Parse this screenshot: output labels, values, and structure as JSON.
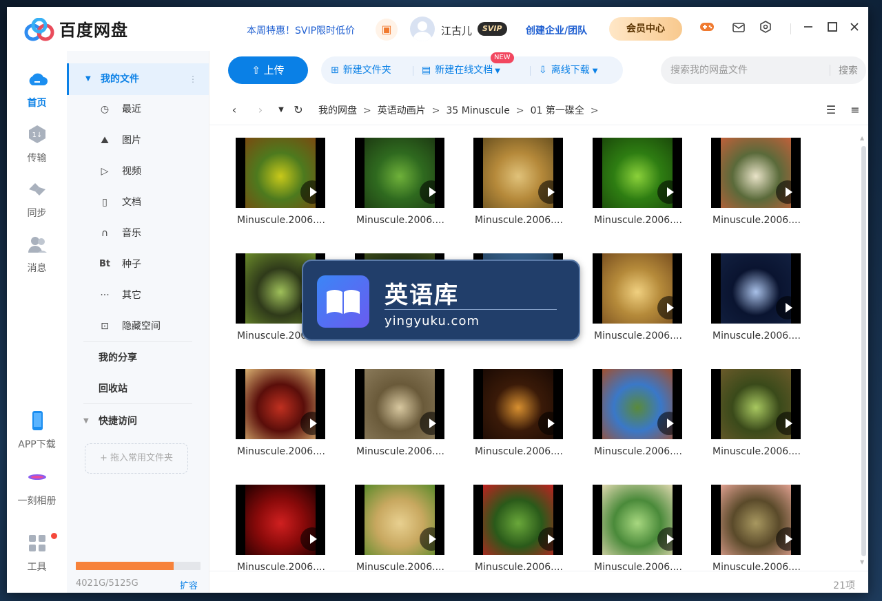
{
  "titlebar": {
    "brand": "百度网盘",
    "promo": "本周特惠！SVIP限时低价",
    "username": "江古儿",
    "svip_badge": "SVIP",
    "team_link": "创建企业/团队",
    "vip_center": "会员中心"
  },
  "rail": {
    "home": "首页",
    "transfer": "传输",
    "sync": "同步",
    "messages": "消息",
    "app_download": "APP下载",
    "album": "一刻相册",
    "tools": "工具"
  },
  "tree": {
    "my_files": "我的文件",
    "items": [
      {
        "label": "最近",
        "icon": "clock-icon"
      },
      {
        "label": "图片",
        "icon": "image-icon"
      },
      {
        "label": "视频",
        "icon": "video-icon"
      },
      {
        "label": "文档",
        "icon": "document-icon"
      },
      {
        "label": "音乐",
        "icon": "headphones-icon"
      },
      {
        "label": "种子",
        "icon": "bt-icon"
      },
      {
        "label": "其它",
        "icon": "more-icon"
      },
      {
        "label": "隐藏空间",
        "icon": "lock-icon"
      }
    ],
    "my_share": "我的分享",
    "recycle": "回收站",
    "quick_access": "快捷访问",
    "drop_hint": "+ 拖入常用文件夹",
    "quota_text": "4021G/5125G",
    "quota_used_fraction": 0.785,
    "expand": "扩容"
  },
  "toolbar": {
    "upload": "上传",
    "new_folder": "新建文件夹",
    "new_online_doc": "新建在线文档",
    "new_tag": "NEW",
    "offline_download": "离线下载",
    "search_placeholder": "搜索我的网盘文件",
    "search_button": "搜索"
  },
  "breadcrumb": [
    "我的网盘",
    "英语动画片",
    "35 Minuscule",
    "01 第一碟全"
  ],
  "files": [
    {
      "name": "Minuscule.2006...."
    },
    {
      "name": "Minuscule.2006...."
    },
    {
      "name": "Minuscule.2006...."
    },
    {
      "name": "Minuscule.2006...."
    },
    {
      "name": "Minuscule.2006...."
    },
    {
      "name": "Minuscule.2006...."
    },
    {
      "name": "Minuscule.2006...."
    },
    {
      "name": "Minuscule.2006...."
    },
    {
      "name": "Minuscule.2006...."
    },
    {
      "name": "Minuscule.2006...."
    },
    {
      "name": "Minuscule.2006...."
    },
    {
      "name": "Minuscule.2006...."
    },
    {
      "name": "Minuscule.2006...."
    },
    {
      "name": "Minuscule.2006...."
    },
    {
      "name": "Minuscule.2006...."
    },
    {
      "name": "Minuscule.2006...."
    },
    {
      "name": "Minuscule.2006...."
    },
    {
      "name": "Minuscule.2006...."
    },
    {
      "name": "Minuscule.2006...."
    },
    {
      "name": "Minuscule.2006...."
    }
  ],
  "item_count": "21项",
  "watermark": {
    "title": "英语库",
    "url": "yingyuku.com"
  },
  "colors": {
    "accent": "#0a80e6",
    "quota_fill": "#f7823a"
  }
}
